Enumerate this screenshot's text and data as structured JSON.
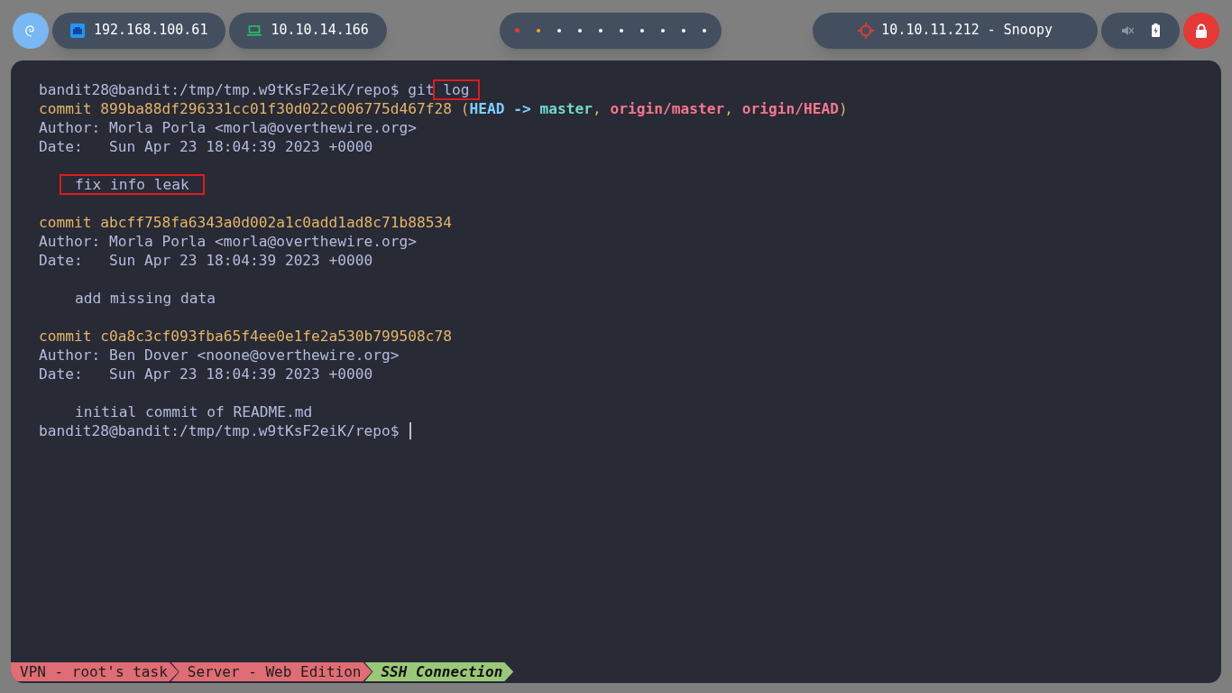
{
  "top_bar": {
    "left": [
      {
        "kind": "ethernet",
        "text": "192.168.100.61"
      },
      {
        "kind": "laptop",
        "text": "10.10.14.166"
      }
    ],
    "workspaces": [
      {
        "color": "#e53935",
        "selected": true
      },
      {
        "color": "#f5a623",
        "selected": false
      },
      {
        "color": "#ffffff",
        "selected": false
      },
      {
        "color": "#ffffff",
        "selected": false
      },
      {
        "color": "#ffffff",
        "selected": false
      },
      {
        "color": "#ffffff",
        "selected": false
      },
      {
        "color": "#ffffff",
        "selected": false
      },
      {
        "color": "#ffffff",
        "selected": false
      },
      {
        "color": "#ffffff",
        "selected": false
      },
      {
        "color": "#ffffff",
        "selected": false
      }
    ],
    "target": {
      "text": "10.10.11.212 - Snoopy"
    },
    "muted": true
  },
  "terminal": {
    "lines": [
      {
        "kind": "text",
        "segments": [
          {
            "kind": "plain",
            "text": "bandit28@bandit:/tmp/tmp.w9tKsF2eiK/repo$ git "
          },
          {
            "kind": "plain",
            "text": "log",
            "highlighted": true
          }
        ]
      },
      {
        "kind": "text",
        "segments": [
          {
            "kind": "commit",
            "text": "commit 899ba88df296331cc01f30d022c006775d467f28 ("
          },
          {
            "kind": "head",
            "text": "HEAD -> "
          },
          {
            "kind": "branch",
            "text": "master"
          },
          {
            "kind": "commit",
            "text": ", "
          },
          {
            "kind": "remote",
            "text": "origin/master"
          },
          {
            "kind": "commit",
            "text": ", "
          },
          {
            "kind": "remote",
            "text": "origin/HEAD"
          },
          {
            "kind": "commit",
            "text": ")"
          }
        ]
      },
      {
        "kind": "text",
        "segments": [
          {
            "kind": "plain",
            "text": "Author: Morla Porla <morla@overthewire.org>"
          }
        ]
      },
      {
        "kind": "text",
        "segments": [
          {
            "kind": "plain",
            "text": "Date:   Sun Apr 23 18:04:39 2023 +0000"
          }
        ]
      },
      {
        "kind": "blank"
      },
      {
        "kind": "message",
        "segments": [
          {
            "kind": "plain",
            "text": "fix info leak",
            "highlighted": true
          }
        ]
      },
      {
        "kind": "blank"
      },
      {
        "kind": "text",
        "segments": [
          {
            "kind": "commit",
            "text": "commit abcff758fa6343a0d002a1c0add1ad8c71b88534"
          }
        ]
      },
      {
        "kind": "text",
        "segments": [
          {
            "kind": "plain",
            "text": "Author: Morla Porla <morla@overthewire.org>"
          }
        ]
      },
      {
        "kind": "text",
        "segments": [
          {
            "kind": "plain",
            "text": "Date:   Sun Apr 23 18:04:39 2023 +0000"
          }
        ]
      },
      {
        "kind": "blank"
      },
      {
        "kind": "message",
        "segments": [
          {
            "kind": "plain",
            "text": "add missing data"
          }
        ]
      },
      {
        "kind": "blank"
      },
      {
        "kind": "text",
        "segments": [
          {
            "kind": "commit",
            "text": "commit c0a8c3cf093fba65f4ee0e1fe2a530b799508c78"
          }
        ]
      },
      {
        "kind": "text",
        "segments": [
          {
            "kind": "plain",
            "text": "Author: Ben Dover <noone@overthewire.org>"
          }
        ]
      },
      {
        "kind": "text",
        "segments": [
          {
            "kind": "plain",
            "text": "Date:   Sun Apr 23 18:04:39 2023 +0000"
          }
        ]
      },
      {
        "kind": "blank"
      },
      {
        "kind": "message",
        "segments": [
          {
            "kind": "plain",
            "text": "initial commit of README.md"
          }
        ]
      },
      {
        "kind": "text",
        "cursor": true,
        "segments": [
          {
            "kind": "plain",
            "text": "bandit28@bandit:/tmp/tmp.w9tKsF2eiK/repo$ "
          }
        ]
      }
    ]
  },
  "status_bar": [
    {
      "text": "VPN - root's task",
      "selected": false
    },
    {
      "text": "Server - Web Edition",
      "selected": false
    },
    {
      "text": "SSH Connection",
      "selected": true
    }
  ]
}
